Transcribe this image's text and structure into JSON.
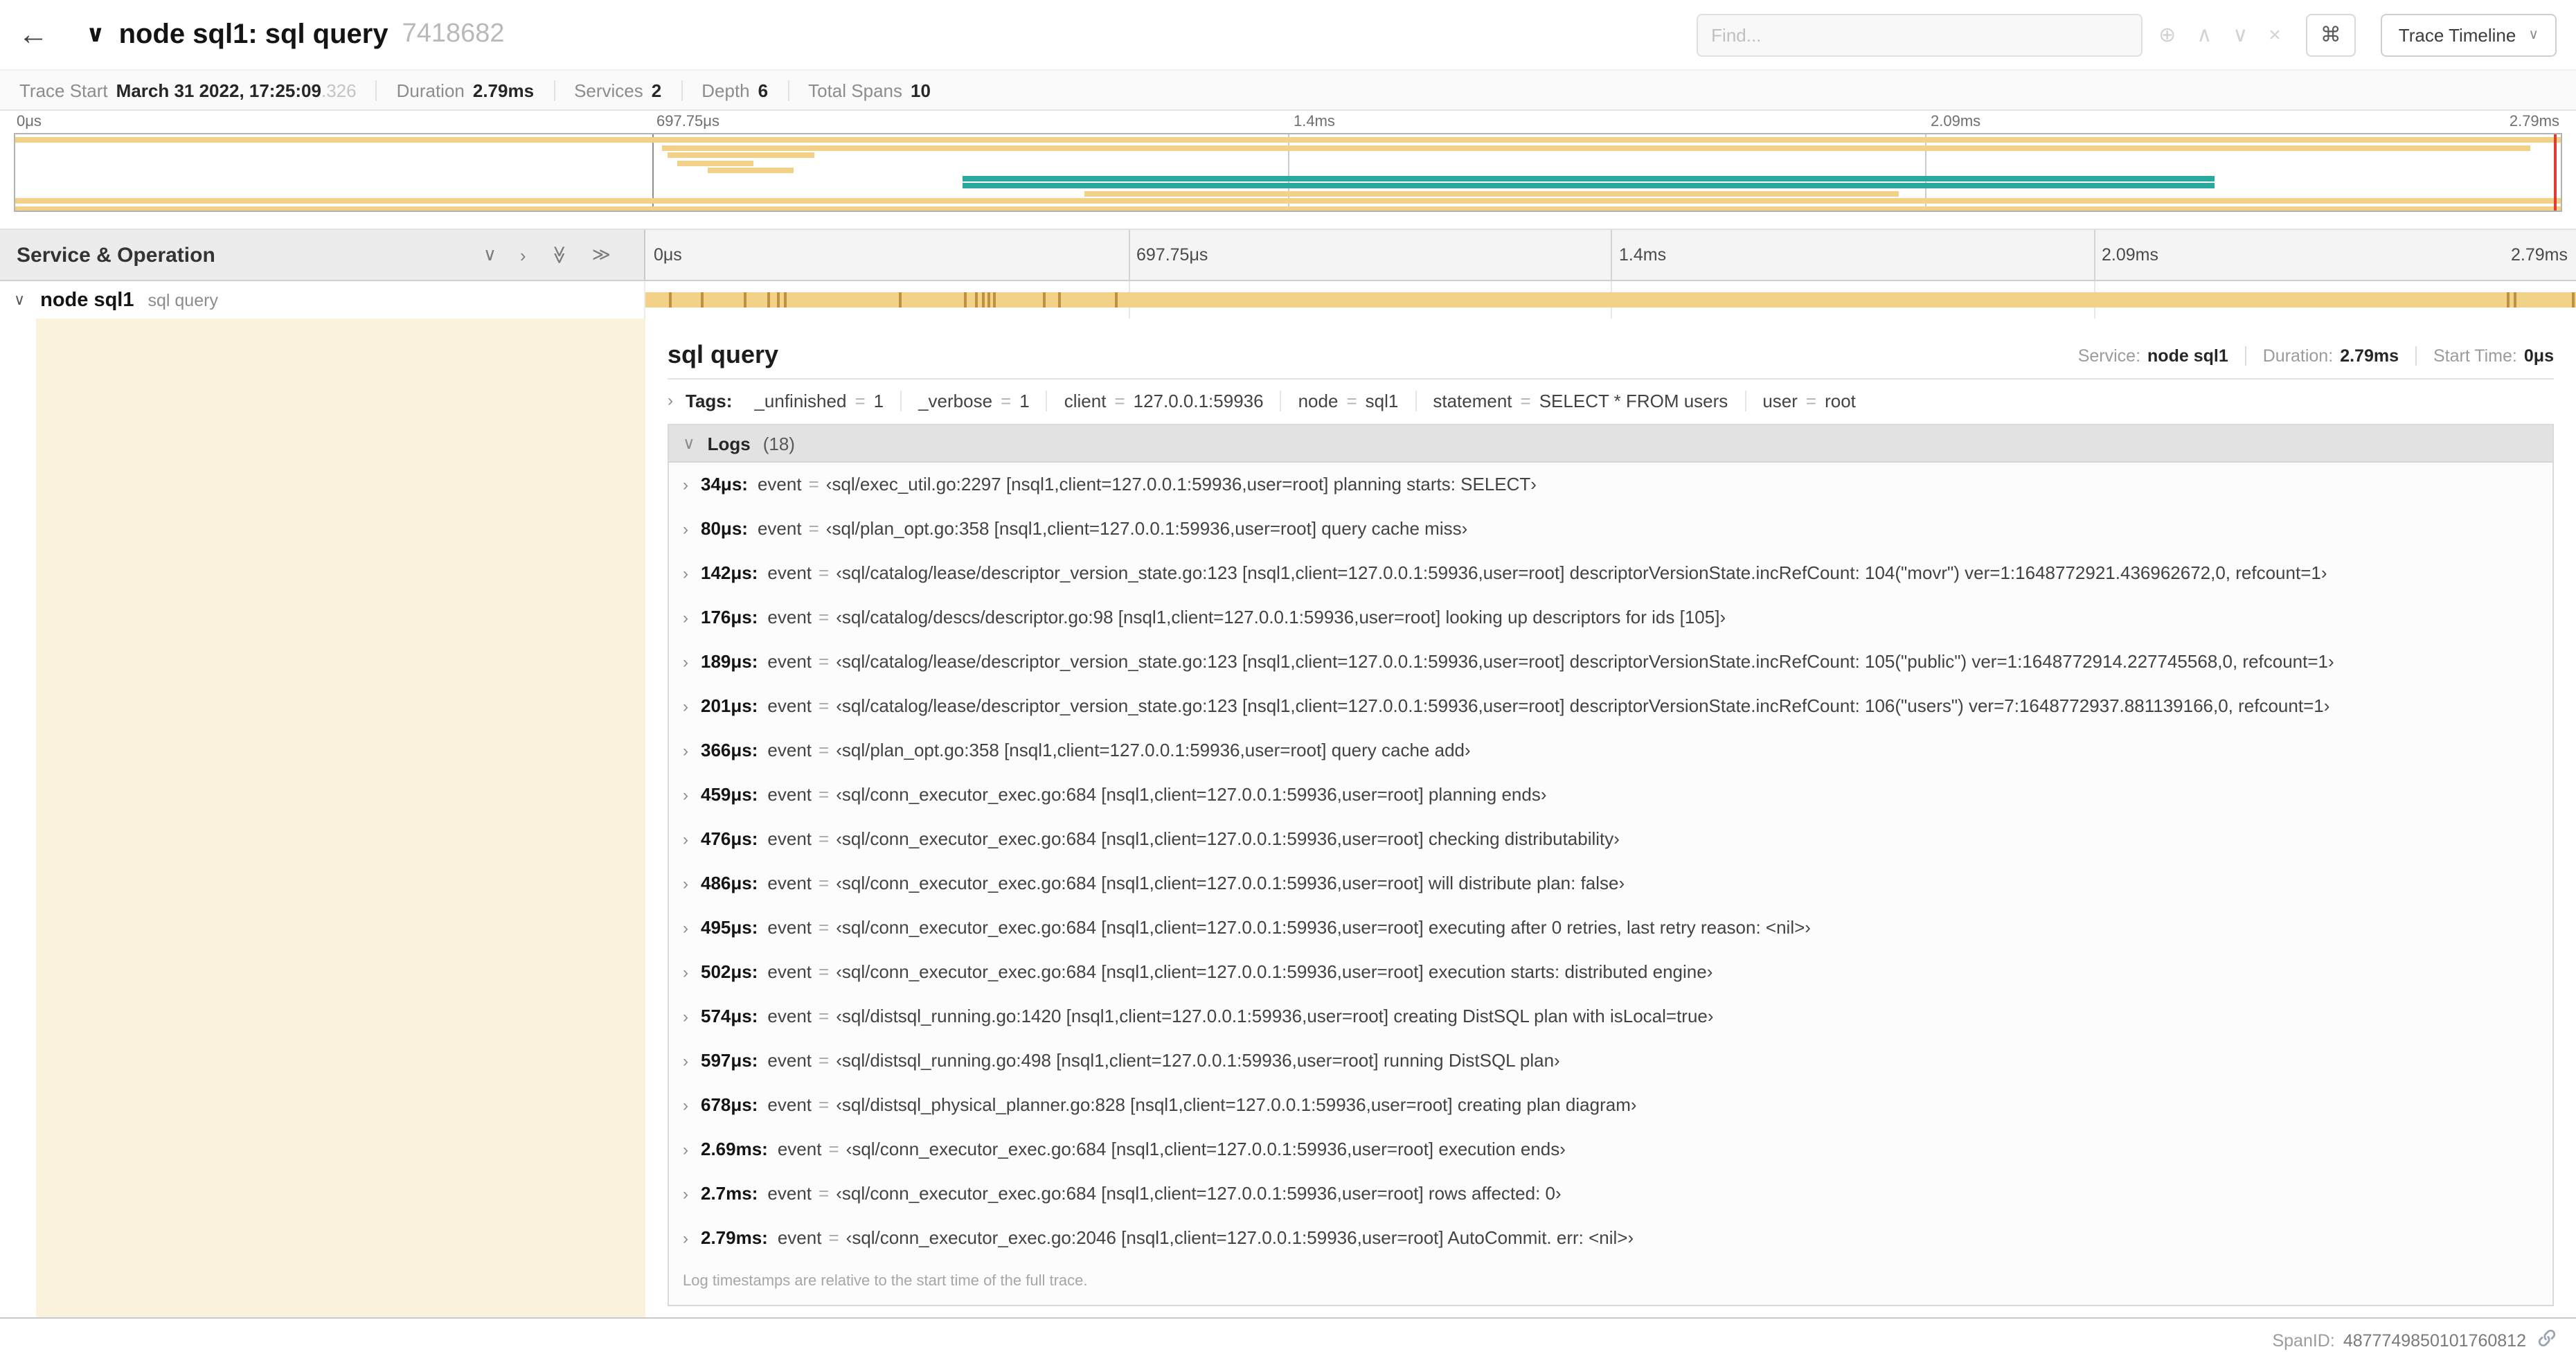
{
  "colors": {
    "span_tan": "#f2d188",
    "span_tan_tick": "#bd9140",
    "span_teal": "#29a8a0",
    "detail_tint": "#fbf2dc",
    "scrubber_red": "#e23b32"
  },
  "icons": {
    "back": "←",
    "collapse_title": "∨",
    "focus": "⊕",
    "prev": "∧",
    "next": "∨",
    "clear": "×",
    "dropdown": "∨",
    "chevron_down": "∨",
    "chevron_right": "›",
    "double_chevron": "≫"
  },
  "header": {
    "title": "node sql1: sql query",
    "trace_id": "7418682",
    "find_placeholder": "Find...",
    "shortcut_key": "⌘",
    "view_options_label": "Trace Timeline"
  },
  "summary": {
    "trace_start_label": "Trace Start",
    "trace_start_value": "March 31 2022, 17:25:09",
    "trace_start_fraction": ".326",
    "duration_label": "Duration",
    "duration_value": "2.79ms",
    "services_label": "Services",
    "services_value": "2",
    "depth_label": "Depth",
    "depth_value": "6",
    "spans_label": "Total Spans",
    "spans_value": "10"
  },
  "minimap": {
    "ticks": [
      "0μs",
      "697.75μs",
      "1.4ms",
      "2.09ms",
      "2.79ms"
    ],
    "spans": [
      {
        "row": 0,
        "start": 0,
        "end": 100,
        "color": "tan"
      },
      {
        "row": 1,
        "start": 25.4,
        "end": 98.8,
        "color": "tan"
      },
      {
        "row": 2,
        "start": 25.6,
        "end": 31.4,
        "color": "tan"
      },
      {
        "row": 3,
        "start": 26.0,
        "end": 29.0,
        "color": "tan"
      },
      {
        "row": 4,
        "start": 27.2,
        "end": 30.6,
        "color": "tan"
      },
      {
        "row": 5,
        "start": 37.2,
        "end": 86.4,
        "color": "teal"
      },
      {
        "row": 6,
        "start": 37.2,
        "end": 86.4,
        "color": "teal"
      },
      {
        "row": 7,
        "start": 42.0,
        "end": 74.0,
        "color": "tan"
      },
      {
        "row": 8,
        "start": 0,
        "end": 100,
        "color": "tan"
      },
      {
        "row": 9,
        "start": 0,
        "end": 100,
        "color": "tan"
      }
    ]
  },
  "timeline": {
    "left_header": "Service & Operation",
    "ticks": [
      "0μs",
      "697.75μs",
      "1.4ms",
      "2.09ms",
      "2.79ms"
    ],
    "span_row": {
      "service": "node sql1",
      "operation": "sql query",
      "tick_positions": [
        1.2,
        2.9,
        5.1,
        6.3,
        6.8,
        7.2,
        13.1,
        16.5,
        17.1,
        17.4,
        17.7,
        18.0,
        20.6,
        21.4,
        24.3,
        96.4,
        96.8,
        99.8
      ]
    }
  },
  "detail": {
    "title": "sql query",
    "service_label": "Service:",
    "service_value": "node sql1",
    "duration_label": "Duration:",
    "duration_value": "2.79ms",
    "start_label": "Start Time:",
    "start_value": "0μs",
    "tags_label": "Tags:",
    "kv_separator": "=",
    "tags": [
      {
        "key": "_unfinished",
        "value": "1"
      },
      {
        "key": "_verbose",
        "value": "1"
      },
      {
        "key": "client",
        "value": "127.0.0.1:59936"
      },
      {
        "key": "node",
        "value": "sql1"
      },
      {
        "key": "statement",
        "value": "SELECT * FROM users"
      },
      {
        "key": "user",
        "value": "root"
      }
    ],
    "logs_label": "Logs",
    "logs_count": "(18)",
    "log_field_key": "event",
    "logs": [
      {
        "time": "34μs:",
        "value": "‹sql/exec_util.go:2297 [nsql1,client=127.0.0.1:59936,user=root] planning starts: SELECT›"
      },
      {
        "time": "80μs:",
        "value": "‹sql/plan_opt.go:358 [nsql1,client=127.0.0.1:59936,user=root] query cache miss›"
      },
      {
        "time": "142μs:",
        "value": "‹sql/catalog/lease/descriptor_version_state.go:123 [nsql1,client=127.0.0.1:59936,user=root] descriptorVersionState.incRefCount: 104(\"movr\") ver=1:1648772921.436962672,0, refcount=1›"
      },
      {
        "time": "176μs:",
        "value": "‹sql/catalog/descs/descriptor.go:98 [nsql1,client=127.0.0.1:59936,user=root] looking up descriptors for ids [105]›"
      },
      {
        "time": "189μs:",
        "value": "‹sql/catalog/lease/descriptor_version_state.go:123 [nsql1,client=127.0.0.1:59936,user=root] descriptorVersionState.incRefCount: 105(\"public\") ver=1:1648772914.227745568,0, refcount=1›"
      },
      {
        "time": "201μs:",
        "value": "‹sql/catalog/lease/descriptor_version_state.go:123 [nsql1,client=127.0.0.1:59936,user=root] descriptorVersionState.incRefCount: 106(\"users\") ver=7:1648772937.881139166,0, refcount=1›"
      },
      {
        "time": "366μs:",
        "value": "‹sql/plan_opt.go:358 [nsql1,client=127.0.0.1:59936,user=root] query cache add›"
      },
      {
        "time": "459μs:",
        "value": "‹sql/conn_executor_exec.go:684 [nsql1,client=127.0.0.1:59936,user=root] planning ends›"
      },
      {
        "time": "476μs:",
        "value": "‹sql/conn_executor_exec.go:684 [nsql1,client=127.0.0.1:59936,user=root] checking distributability›"
      },
      {
        "time": "486μs:",
        "value": "‹sql/conn_executor_exec.go:684 [nsql1,client=127.0.0.1:59936,user=root] will distribute plan: false›"
      },
      {
        "time": "495μs:",
        "value": "‹sql/conn_executor_exec.go:684 [nsql1,client=127.0.0.1:59936,user=root] executing after 0 retries, last retry reason: <nil>›"
      },
      {
        "time": "502μs:",
        "value": "‹sql/conn_executor_exec.go:684 [nsql1,client=127.0.0.1:59936,user=root] execution starts: distributed engine›"
      },
      {
        "time": "574μs:",
        "value": "‹sql/distsql_running.go:1420 [nsql1,client=127.0.0.1:59936,user=root] creating DistSQL plan with isLocal=true›"
      },
      {
        "time": "597μs:",
        "value": "‹sql/distsql_running.go:498 [nsql1,client=127.0.0.1:59936,user=root] running DistSQL plan›"
      },
      {
        "time": "678μs:",
        "value": "‹sql/distsql_physical_planner.go:828 [nsql1,client=127.0.0.1:59936,user=root] creating plan diagram›"
      },
      {
        "time": "2.69ms:",
        "value": "‹sql/conn_executor_exec.go:684 [nsql1,client=127.0.0.1:59936,user=root] execution ends›"
      },
      {
        "time": "2.7ms:",
        "value": "‹sql/conn_executor_exec.go:684 [nsql1,client=127.0.0.1:59936,user=root] rows affected: 0›"
      },
      {
        "time": "2.79ms:",
        "value": "‹sql/conn_executor_exec.go:2046 [nsql1,client=127.0.0.1:59936,user=root] AutoCommit. err: <nil>›"
      }
    ],
    "footnote": "Log timestamps are relative to the start time of the full trace.",
    "span_id_label": "SpanID:",
    "span_id": "4877749850101760812"
  }
}
